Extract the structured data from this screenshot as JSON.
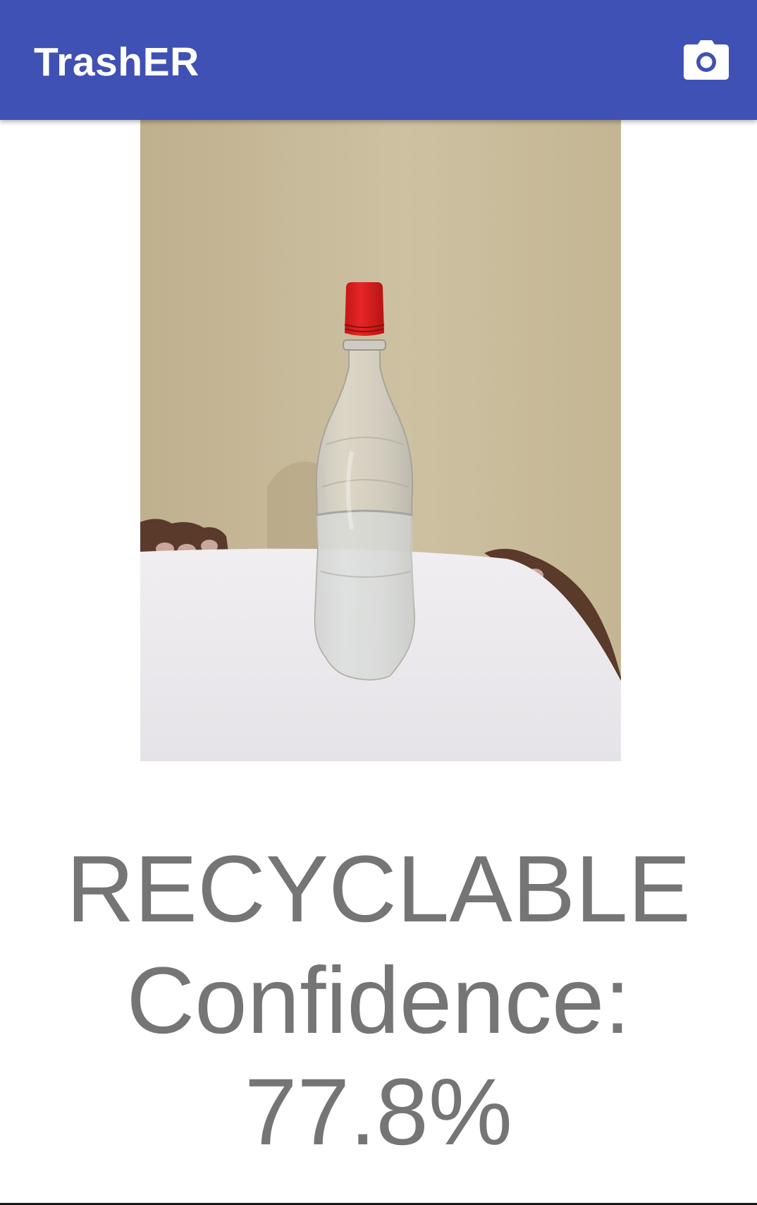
{
  "app_bar": {
    "title": "TrashER",
    "background_color": "#3f51b5",
    "action_icon": "camera-icon"
  },
  "photo": {
    "subject": "clear plastic bottle with red cap"
  },
  "result": {
    "label": "RECYCLABLE",
    "confidence_label": "Confidence:",
    "confidence_value": "77.8%",
    "text_color": "#757575"
  }
}
